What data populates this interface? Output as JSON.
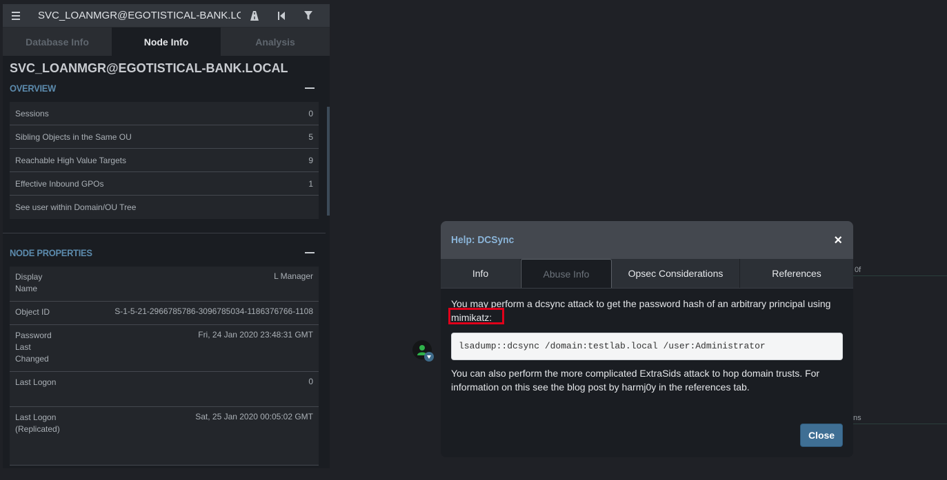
{
  "search": {
    "value": "SVC_LOANMGR@EGOTISTICAL-BANK.LOCAL"
  },
  "tabs": [
    "Database Info",
    "Node Info",
    "Analysis"
  ],
  "node": {
    "title": "SVC_LOANMGR@EGOTISTICAL-BANK.LOCAL",
    "overview_title": "OVERVIEW",
    "overview": [
      {
        "label": "Sessions",
        "value": "0"
      },
      {
        "label": "Sibling Objects in the Same OU",
        "value": "5"
      },
      {
        "label": "Reachable High Value Targets",
        "value": "9"
      },
      {
        "label": "Effective Inbound GPOs",
        "value": "1"
      },
      {
        "label": "See user within Domain/OU Tree",
        "value": ""
      }
    ],
    "properties_title": "NODE PROPERTIES",
    "properties": [
      {
        "label": "Display Name",
        "value": "L Manager"
      },
      {
        "label": "Object ID",
        "value": "S-1-5-21-2966785786-3096785034-1186376766-1108"
      },
      {
        "label": "Password Last Changed",
        "value": "Fri, 24 Jan 2020 23:48:31 GMT"
      },
      {
        "label": "Last Logon",
        "value": "0"
      },
      {
        "label": "Last Logon (Replicated)",
        "value": "Sat, 25 Jan 2020 00:05:02 GMT"
      }
    ]
  },
  "graph": {
    "edge_label_1": "0f",
    "edge_label_2": "ns"
  },
  "modal": {
    "title": "Help: DCSync",
    "close_x": "×",
    "tabs": [
      "Info",
      "Abuse Info",
      "Opsec Considerations",
      "References"
    ],
    "active_tab": "Abuse Info",
    "para1": "You may perform a dcsync attack to get the password hash of an arbitrary principal using mimikatz:",
    "code": "lsadump::dcsync /domain:testlab.local /user:Administrator",
    "para2": "You can also perform the more complicated ExtraSids attack to hop domain trusts. For information on this see the blog post by harmj0y in the references tab.",
    "close_button": "Close"
  },
  "colors": {
    "accent": "#5c8bad",
    "highlight": "#e0001a",
    "button": "#3f6f94"
  }
}
